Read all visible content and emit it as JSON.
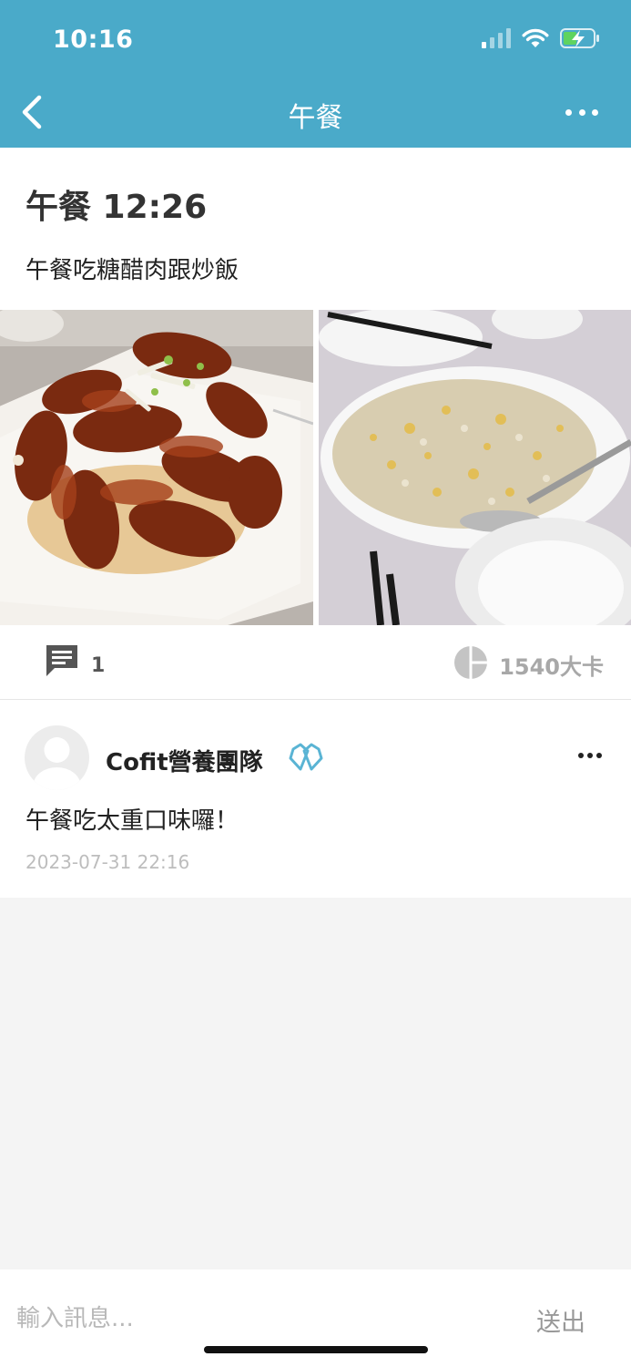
{
  "status_bar": {
    "time": "10:16"
  },
  "nav": {
    "title": "午餐"
  },
  "post": {
    "title": "午餐 12:26",
    "body": "午餐吃糖醋肉跟炒飯",
    "photos": [
      "sweet-and-sour-pork-photo",
      "fried-rice-photo"
    ],
    "comment_count": "1",
    "calories": "1540大卡"
  },
  "comment": {
    "author": "Cofit營養團隊",
    "text": "午餐吃太重口味囉！",
    "time": "2023-07-31 22:16"
  },
  "input": {
    "placeholder": "輸入訊息...",
    "send_label": "送出"
  },
  "colors": {
    "header": "#4aaac9",
    "verified": "#5ab4d4",
    "muted": "#a8a8a8"
  }
}
